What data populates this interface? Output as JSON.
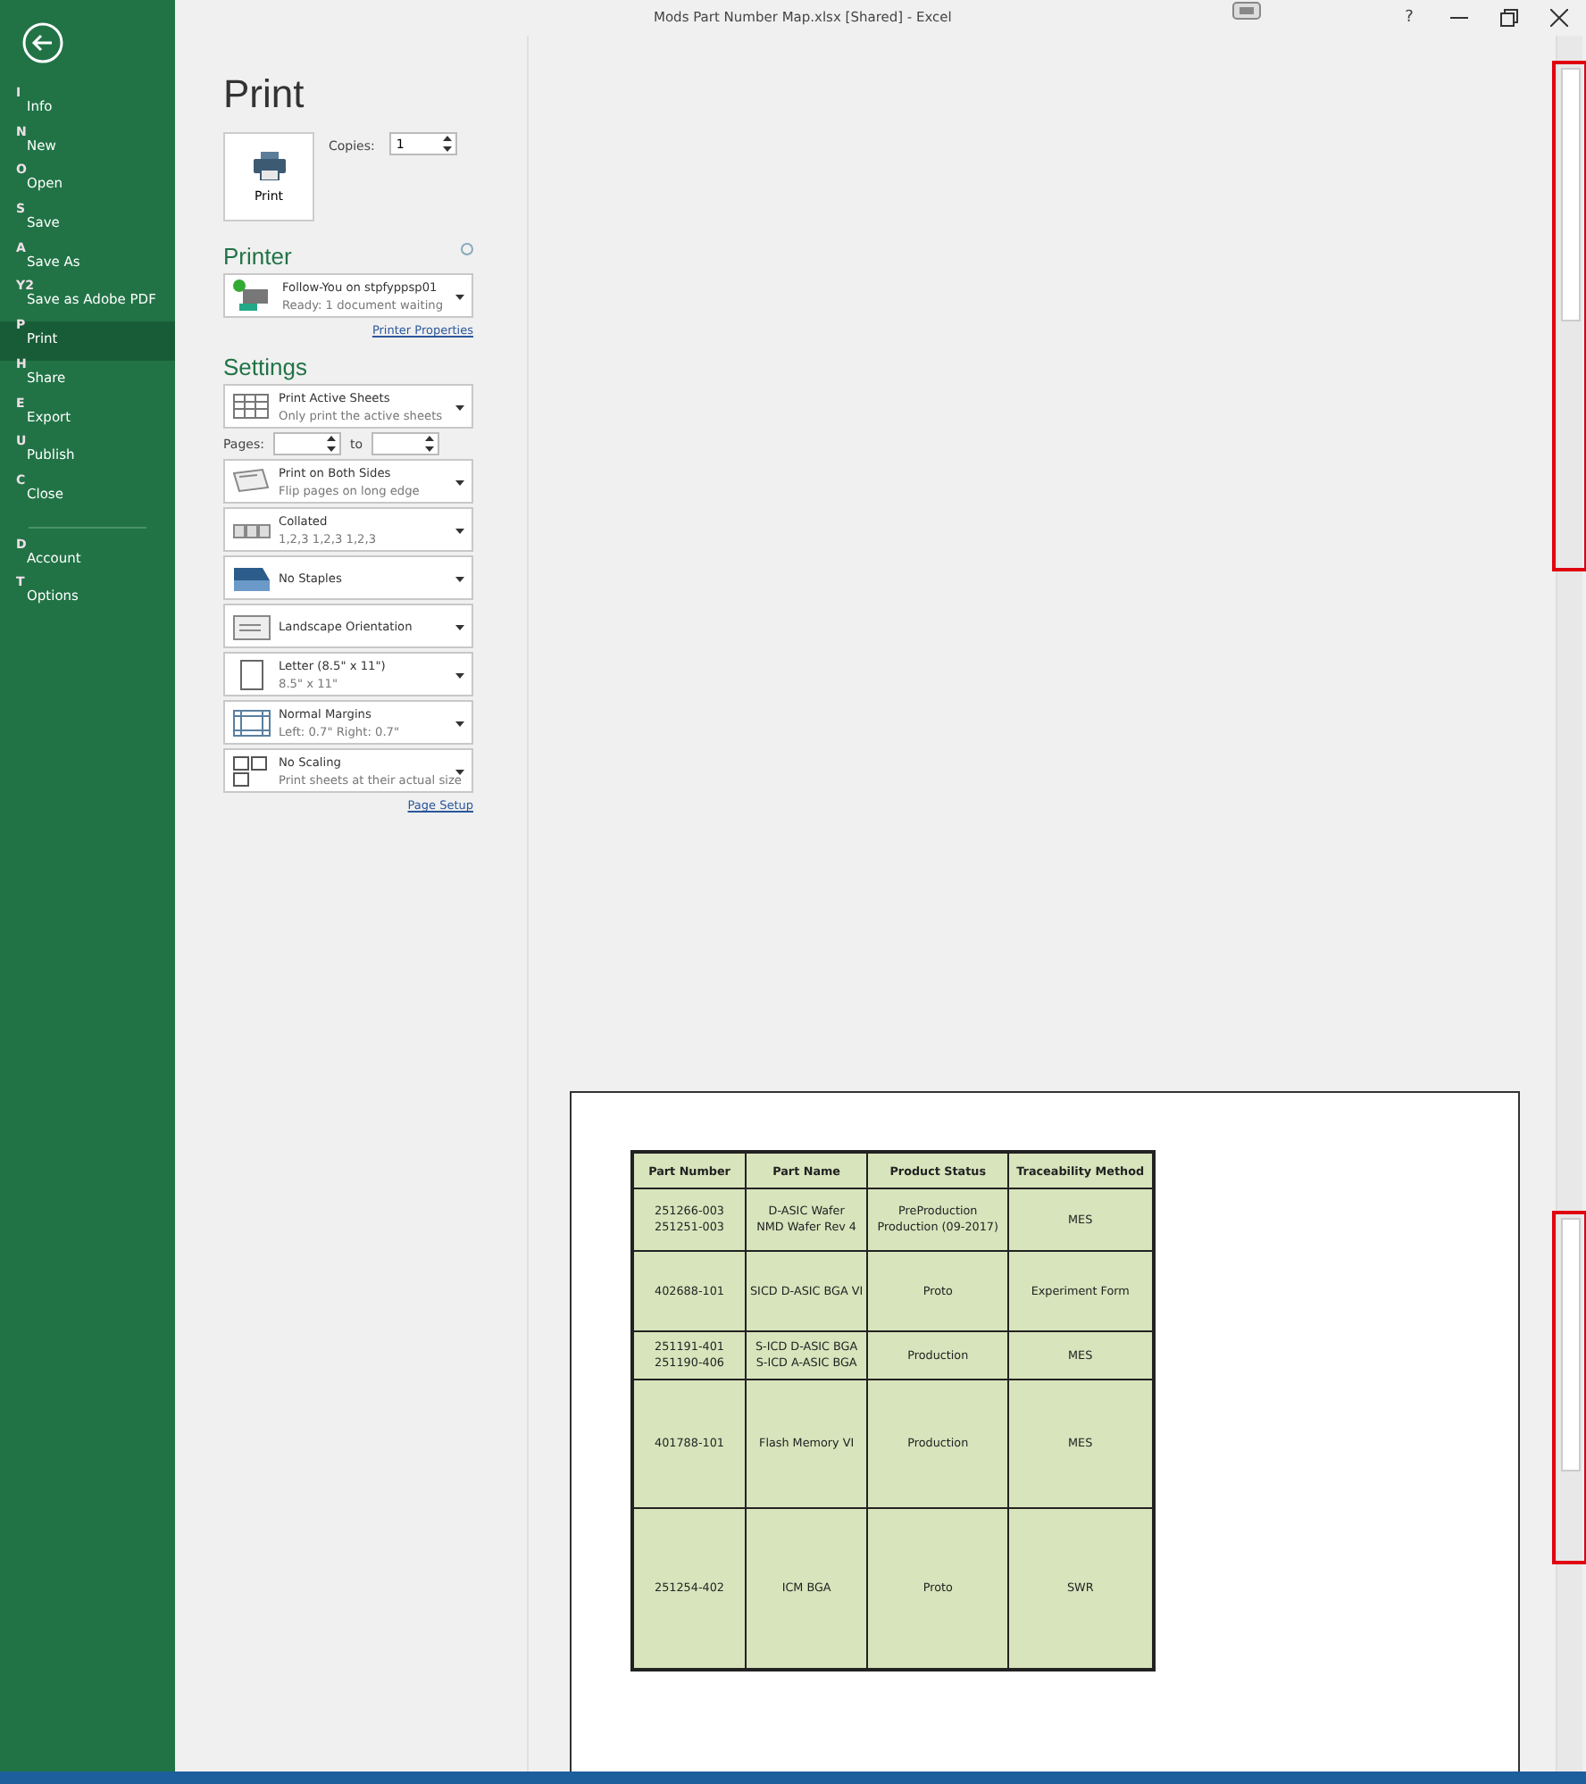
{
  "window": {
    "title": "Mods Part Number Map.xlsx  [Shared]  -  Excel",
    "help": "?"
  },
  "sidebar": {
    "items": [
      {
        "key": "I",
        "label": "Info",
        "selected": false
      },
      {
        "key": "N",
        "label": "New",
        "selected": false
      },
      {
        "key": "O",
        "label": "Open",
        "selected": false
      },
      {
        "key": "S",
        "label": "Save",
        "selected": false
      },
      {
        "key": "A",
        "label": "Save As",
        "selected": false
      },
      {
        "key": "Y2",
        "label": "Save as Adobe PDF",
        "selected": false
      },
      {
        "key": "P",
        "label": "Print",
        "selected": true
      },
      {
        "key": "H",
        "label": "Share",
        "selected": false
      },
      {
        "key": "E",
        "label": "Export",
        "selected": false
      },
      {
        "key": "U",
        "label": "Publish",
        "selected": false
      },
      {
        "key": "C",
        "label": "Close",
        "selected": false
      }
    ],
    "bottom_items": [
      {
        "key": "D",
        "label": "Account",
        "selected": false
      },
      {
        "key": "T",
        "label": "Options",
        "selected": false
      }
    ]
  },
  "print": {
    "heading": "Print",
    "button": "Print",
    "copies_label": "Copies:",
    "copies": "1",
    "printer_heading": "Printer",
    "printer": {
      "name": "Follow-You on stpfyppsp01",
      "status": "Ready: 1 document waiting"
    },
    "printer_properties": "Printer Properties",
    "settings_heading": "Settings",
    "settings": [
      {
        "kind": "sheets",
        "title": "Print Active Sheets",
        "subtitle": "Only print the active sheets"
      },
      {
        "kind": "pages",
        "label": "Pages:",
        "to": "to"
      },
      {
        "kind": "duplex",
        "title": "Print on Both Sides",
        "subtitle": "Flip pages on long edge"
      },
      {
        "kind": "collated",
        "title": "Collated",
        "subtitle": "1,2,3    1,2,3    1,2,3"
      },
      {
        "kind": "staples",
        "title": "No Staples"
      },
      {
        "kind": "orientation",
        "title": "Landscape Orientation"
      },
      {
        "kind": "paper",
        "title": "Letter (8.5\" x 11\")",
        "subtitle": "8.5\" x 11\""
      },
      {
        "kind": "margins",
        "title": "Normal Margins",
        "subtitle": "Left:  0.7\"    Right:  0.7\""
      },
      {
        "kind": "scaling",
        "title": "No Scaling",
        "subtitle": "Print sheets at their actual size"
      }
    ],
    "page_setup": "Page Setup"
  },
  "preview": {
    "table": {
      "columns": [
        "Part Number",
        "Part Name",
        "Product Status",
        "Traceability Method"
      ],
      "rows": [
        [
          [
            "251266-003",
            "251251-003"
          ],
          [
            "D-ASIC Wafer",
            "NMD Wafer Rev 4"
          ],
          [
            "PreProduction",
            "Production (09-2017)"
          ],
          [
            "MES"
          ]
        ],
        [
          [
            "402688-101"
          ],
          [
            "SICD D-ASIC BGA VI"
          ],
          [
            "Proto"
          ],
          [
            "Experiment Form"
          ]
        ],
        [
          [
            "251191-401",
            "251190-406"
          ],
          [
            "S-ICD D-ASIC BGA",
            "S-ICD A-ASIC BGA"
          ],
          [
            "Production"
          ],
          [
            "MES"
          ]
        ],
        [
          [
            "401788-101"
          ],
          [
            "Flash Memory VI"
          ],
          [
            "Production"
          ],
          [
            "MES"
          ]
        ],
        [
          [
            "251254-402"
          ],
          [
            "ICM BGA"
          ],
          [
            "Proto"
          ],
          [
            "SWR"
          ]
        ]
      ]
    }
  }
}
